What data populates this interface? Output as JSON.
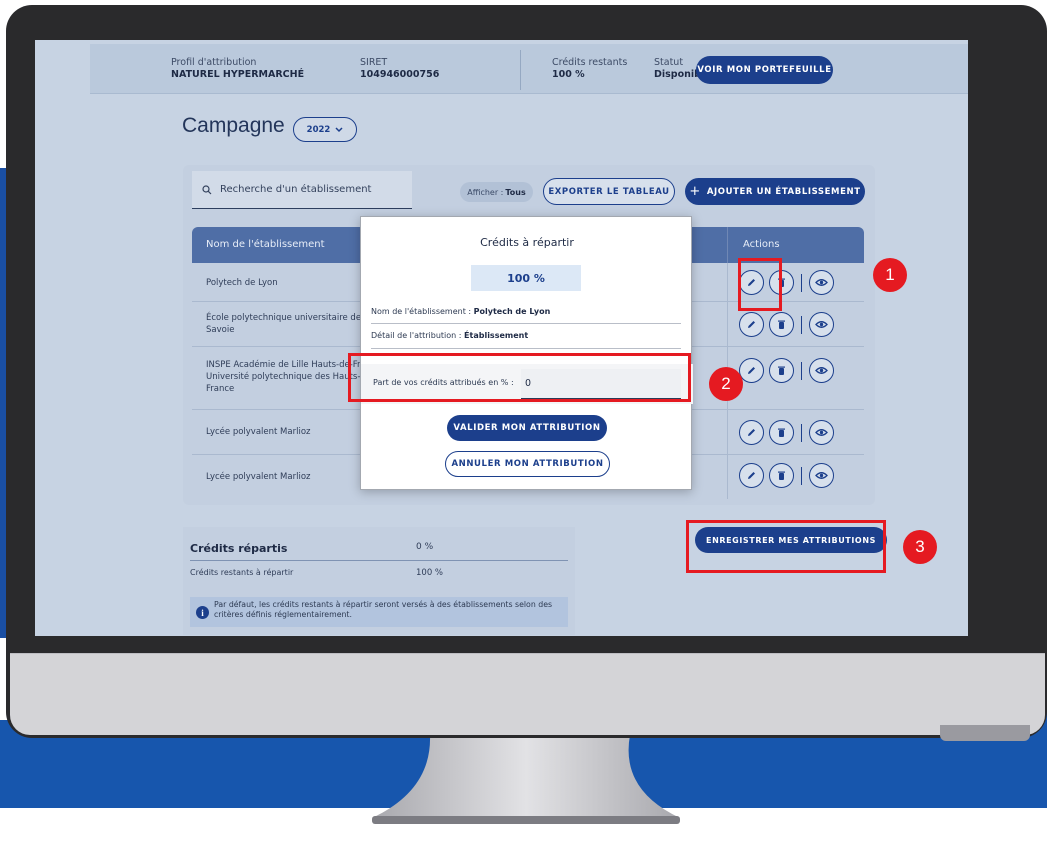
{
  "topbar": {
    "profil_label": "Profil d'attribution",
    "profil_value": "NATUREL HYPERMARCHÉ",
    "siret_label": "SIRET",
    "siret_value": "104946000756",
    "credits_label": "Crédits restants",
    "credits_value": "100 %",
    "statut_label": "Statut",
    "statut_value": "Disponible",
    "portfolio_button": "VOIR MON PORTEFEUILLE"
  },
  "campagne": {
    "title": "Campagne",
    "year": "2022"
  },
  "toolbar": {
    "search_placeholder": "Recherche d'un établissement",
    "afficher_label": "Afficher :",
    "afficher_value": "Tous",
    "export_button": "EXPORTER LE TABLEAU",
    "add_button": "AJOUTER UN ÉTABLISSEMENT"
  },
  "table": {
    "headers": [
      "Nom de l'établissement",
      "Actions"
    ],
    "rows": [
      {
        "name": "Polytech de Lyon"
      },
      {
        "name": "École polytechnique universitaire de Savoie"
      },
      {
        "name": "INSPE Académie de Lille Hauts-de-France Université polytechnique des Hauts-de-France"
      },
      {
        "name": "Lycée polyvalent Marlioz"
      },
      {
        "name": "Lycée polyvalent Marlioz"
      }
    ]
  },
  "modal": {
    "title": "Crédits à répartir",
    "percent": "100 %",
    "etab_label": "Nom de l'établissement :",
    "etab_value": "Polytech de Lyon",
    "detail_label": "Détail de l'attribution :",
    "detail_value": "Établissement",
    "input_label": "Part de vos crédits attribués en % :",
    "input_value": "0",
    "validate_button": "VALIDER MON ATTRIBUTION",
    "cancel_button": "ANNULER MON ATTRIBUTION"
  },
  "summary": {
    "title": "Crédits répartis",
    "title_value": "0 %",
    "remaining_label": "Crédits restants à répartir",
    "remaining_value": "100 %",
    "info_text": "Par défaut, les crédits restants à répartir seront versés à des établissements selon des critères définis réglementairement.",
    "save_button": "ENREGISTRER MES ATTRIBUTIONS"
  },
  "annotations": [
    "1",
    "2",
    "3"
  ],
  "colors": {
    "accent": "#1c3f8c",
    "highlight": "#e51a21",
    "backdrop": "#1756ad"
  }
}
